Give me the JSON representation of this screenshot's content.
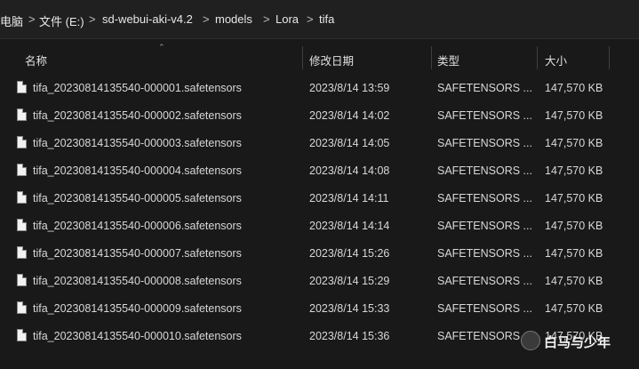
{
  "breadcrumb": {
    "items": [
      {
        "label": "电脑"
      },
      {
        "label": "文件 (E:)"
      },
      {
        "label": "sd-webui-aki-v4.2"
      },
      {
        "label": "models"
      },
      {
        "label": "Lora"
      },
      {
        "label": "tifa"
      }
    ],
    "separator": ">"
  },
  "columns": {
    "name": "名称",
    "modified": "修改日期",
    "type": "类型",
    "size": "大小"
  },
  "files": [
    {
      "name": "tifa_20230814135540-000001.safetensors",
      "modified": "2023/8/14 13:59",
      "type": "SAFETENSORS ...",
      "size": "147,570 KB"
    },
    {
      "name": "tifa_20230814135540-000002.safetensors",
      "modified": "2023/8/14 14:02",
      "type": "SAFETENSORS ...",
      "size": "147,570 KB"
    },
    {
      "name": "tifa_20230814135540-000003.safetensors",
      "modified": "2023/8/14 14:05",
      "type": "SAFETENSORS ...",
      "size": "147,570 KB"
    },
    {
      "name": "tifa_20230814135540-000004.safetensors",
      "modified": "2023/8/14 14:08",
      "type": "SAFETENSORS ...",
      "size": "147,570 KB"
    },
    {
      "name": "tifa_20230814135540-000005.safetensors",
      "modified": "2023/8/14 14:11",
      "type": "SAFETENSORS ...",
      "size": "147,570 KB"
    },
    {
      "name": "tifa_20230814135540-000006.safetensors",
      "modified": "2023/8/14 14:14",
      "type": "SAFETENSORS ...",
      "size": "147,570 KB"
    },
    {
      "name": "tifa_20230814135540-000007.safetensors",
      "modified": "2023/8/14 15:26",
      "type": "SAFETENSORS ...",
      "size": "147,570 KB"
    },
    {
      "name": "tifa_20230814135540-000008.safetensors",
      "modified": "2023/8/14 15:29",
      "type": "SAFETENSORS ...",
      "size": "147,570 KB"
    },
    {
      "name": "tifa_20230814135540-000009.safetensors",
      "modified": "2023/8/14 15:33",
      "type": "SAFETENSORS ...",
      "size": "147,570 KB"
    },
    {
      "name": "tifa_20230814135540-000010.safetensors",
      "modified": "2023/8/14 15:36",
      "type": "SAFETENSORS ...",
      "size": "147,570 KB"
    }
  ],
  "watermark": {
    "text": "白马与少年"
  },
  "icons": {
    "file": "file-icon",
    "sort": "sort-up-icon",
    "chevron": "chevron-right-icon"
  },
  "colors": {
    "background": "#191919",
    "text": "#d6d6d6",
    "address_bar": "#202020"
  }
}
